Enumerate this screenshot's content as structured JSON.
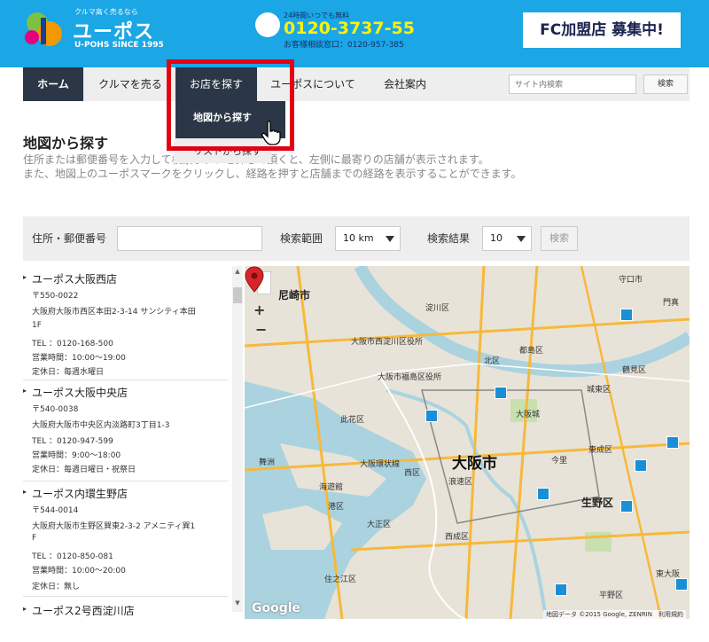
{
  "header": {
    "logo": {
      "tagline": "クルマ高く売るなら",
      "name": "ユーポス",
      "since": "U-POHS SINCE 1995"
    },
    "phone": {
      "hours": "24時間いつでも無料",
      "number": "0120-3737-55",
      "sub": "お客様相談窓口：0120-957-385"
    },
    "fc_banner": "FC加盟店 募集中!"
  },
  "nav": {
    "items": [
      "ホーム",
      "クルマを売る",
      "お店を探す",
      "ユーポスについて",
      "会社案内"
    ],
    "search_placeholder": "サイト内検索",
    "search_button": "検索"
  },
  "dropdown": {
    "items": [
      "地図から探す",
      "リストから探す"
    ]
  },
  "page": {
    "title": "地図から探す",
    "desc": [
      "住所または郵便番号を入力して検索ボタンを押して頂くと、左側に最寄りの店舗が表示されます。",
      "また、地図上のユーポスマークをクリックし、経路を押すと店舗までの経路を表示することができます。"
    ]
  },
  "form": {
    "address_label": "住所・郵便番号",
    "range_label": "検索範囲",
    "range_value": "10 km",
    "result_label": "検索結果",
    "result_value": "10",
    "search_button": "検索"
  },
  "shops": [
    {
      "name": "ユーポス大阪西店",
      "postal": "〒550-0022",
      "address": [
        "大阪府大阪市西区本田2-3-14 サンシティ本田",
        "1F"
      ],
      "tel": "TEL ：0120-168-500",
      "hours": "営業時間：10:00～19:00",
      "holiday": "定休日：毎週水曜日"
    },
    {
      "name": "ユーポス大阪中央店",
      "postal": "〒540-0038",
      "address": [
        "大阪府大阪市中央区内淡路町3丁目1-3"
      ],
      "tel": "TEL ：0120-947-599",
      "hours": "営業時間：9:00～18:00",
      "holiday": "定休日：毎週日曜日・祝祭日"
    },
    {
      "name": "ユーポス内環生野店",
      "postal": "〒544-0014",
      "address": [
        "大阪府大阪市生野区巽東2-3-2 アメニティ巽1",
        "F"
      ],
      "tel": "TEL ：0120-850-081",
      "hours": "営業時間：10:00～20:00",
      "holiday": "定休日：無し"
    },
    {
      "name": "ユーポス2号西淀川店"
    }
  ],
  "map": {
    "labels": {
      "amagasaki": "尼崎市",
      "yodogawa": "淀川区",
      "moriguchi": "守口市",
      "kadoma": "門真",
      "miyakojima": "都島区",
      "tsurumi": "鶴見区",
      "joto": "城東区",
      "osaka_city": "大阪市",
      "naniwa": "浪速区",
      "higashinari": "東成区",
      "ikuno": "生野区",
      "nishinari": "西成区",
      "taisho": "大正区",
      "suminoe": "住之江区",
      "hirano": "平野区",
      "higashiosaka": "東大阪",
      "nishi_ku": "西区",
      "minato": "港区",
      "konohana": "此花区",
      "nishiyodogawa": "大阪市西淀川区役所",
      "fukushima": "大阪市福島区役所",
      "kitaku": "北区",
      "maishima": "舞洲",
      "kaiyukan": "海遊館",
      "osakajo": "大阪城",
      "imazato": "今里",
      "kanjo": "大阪環状線"
    },
    "zoom_in": "+",
    "zoom_out": "−",
    "google": "Google",
    "attribution": "地図データ ©2015 Google, ZENRIN　利用規約"
  }
}
